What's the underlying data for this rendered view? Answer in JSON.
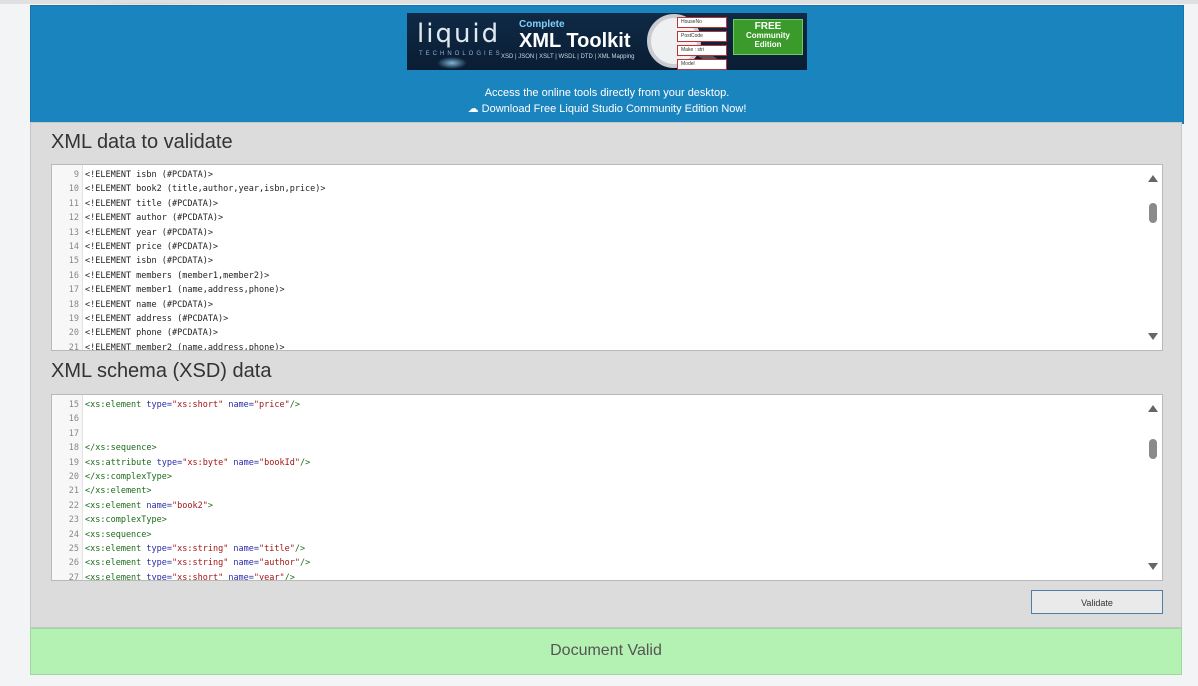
{
  "banner": {
    "logo_text": "liquid",
    "logo_sub": "TECHNOLOGIES",
    "complete": "Complete",
    "product": "XML Toolkit",
    "formats": "XSD | JSON | XSLT | WSDL | DTD | XML Mapping",
    "magnifier_rows": [
      "HouseNo",
      "PostCode",
      "Make : stri",
      "Model"
    ],
    "free_big": "FREE",
    "free_small": "Community Edition"
  },
  "header": {
    "access_text": "Access the online tools directly from your desktop.",
    "download_text": "Download Free Liquid Studio Community Edition Now!"
  },
  "xml_section": {
    "title": "XML data to validate",
    "lines": [
      {
        "n": "9",
        "text": "<!ELEMENT isbn (#PCDATA)>"
      },
      {
        "n": "10",
        "text": "<!ELEMENT book2 (title,author,year,isbn,price)>"
      },
      {
        "n": "11",
        "text": "<!ELEMENT title (#PCDATA)>"
      },
      {
        "n": "12",
        "text": "<!ELEMENT author (#PCDATA)>"
      },
      {
        "n": "13",
        "text": "<!ELEMENT year (#PCDATA)>"
      },
      {
        "n": "14",
        "text": "<!ELEMENT price (#PCDATA)>"
      },
      {
        "n": "15",
        "text": "<!ELEMENT isbn (#PCDATA)>"
      },
      {
        "n": "16",
        "text": "<!ELEMENT members (member1,member2)>"
      },
      {
        "n": "17",
        "text": "<!ELEMENT member1 (name,address,phone)>"
      },
      {
        "n": "18",
        "text": "<!ELEMENT name (#PCDATA)>"
      },
      {
        "n": "19",
        "text": "<!ELEMENT address (#PCDATA)>"
      },
      {
        "n": "20",
        "text": "<!ELEMENT phone (#PCDATA)>"
      },
      {
        "n": "21",
        "text": "<!ELEMENT member2 (name,address,phone)>"
      }
    ]
  },
  "xsd_section": {
    "title": "XML schema (XSD) data",
    "lines": [
      {
        "n": "15",
        "parts": [
          [
            "tag",
            "<xs:element "
          ],
          [
            "attr",
            "type="
          ],
          [
            "val",
            "\"xs:short\""
          ],
          [
            "attr",
            " name="
          ],
          [
            "val",
            "\"price\""
          ],
          [
            "tag",
            "/>"
          ]
        ]
      },
      {
        "n": "16",
        "parts": []
      },
      {
        "n": "17",
        "parts": []
      },
      {
        "n": "18",
        "parts": [
          [
            "tag",
            "</xs:sequence>"
          ]
        ]
      },
      {
        "n": "19",
        "parts": [
          [
            "tag",
            "<xs:attribute "
          ],
          [
            "attr",
            "type="
          ],
          [
            "val",
            "\"xs:byte\""
          ],
          [
            "attr",
            " name="
          ],
          [
            "val",
            "\"bookId\""
          ],
          [
            "tag",
            "/>"
          ]
        ]
      },
      {
        "n": "20",
        "parts": [
          [
            "tag",
            "</xs:complexType>"
          ]
        ]
      },
      {
        "n": "21",
        "parts": [
          [
            "tag",
            "</xs:element>"
          ]
        ]
      },
      {
        "n": "22",
        "parts": [
          [
            "tag",
            "<xs:element "
          ],
          [
            "attr",
            "name="
          ],
          [
            "val",
            "\"book2\""
          ],
          [
            "tag",
            ">"
          ]
        ]
      },
      {
        "n": "23",
        "parts": [
          [
            "tag",
            "<xs:complexType>"
          ]
        ]
      },
      {
        "n": "24",
        "parts": [
          [
            "tag",
            "<xs:sequence>"
          ]
        ]
      },
      {
        "n": "25",
        "parts": [
          [
            "tag",
            "<xs:element "
          ],
          [
            "attr",
            "type="
          ],
          [
            "val",
            "\"xs:string\""
          ],
          [
            "attr",
            " name="
          ],
          [
            "val",
            "\"title\""
          ],
          [
            "tag",
            "/>"
          ]
        ]
      },
      {
        "n": "26",
        "parts": [
          [
            "tag",
            "<xs:element "
          ],
          [
            "attr",
            "type="
          ],
          [
            "val",
            "\"xs:string\""
          ],
          [
            "attr",
            " name="
          ],
          [
            "val",
            "\"author\""
          ],
          [
            "tag",
            "/>"
          ]
        ]
      },
      {
        "n": "27",
        "parts": [
          [
            "tag",
            "<xs:element "
          ],
          [
            "attr",
            "type="
          ],
          [
            "val",
            "\"xs:short\""
          ],
          [
            "attr",
            " name="
          ],
          [
            "val",
            "\"year\""
          ],
          [
            "tag",
            "/>"
          ]
        ]
      }
    ]
  },
  "validate_button": "Validate",
  "result_text": "Document Valid",
  "colors": {
    "header_bg": "#1a84bf",
    "panel_bg": "#dcdcdc",
    "result_bg": "#b3f2b3"
  }
}
